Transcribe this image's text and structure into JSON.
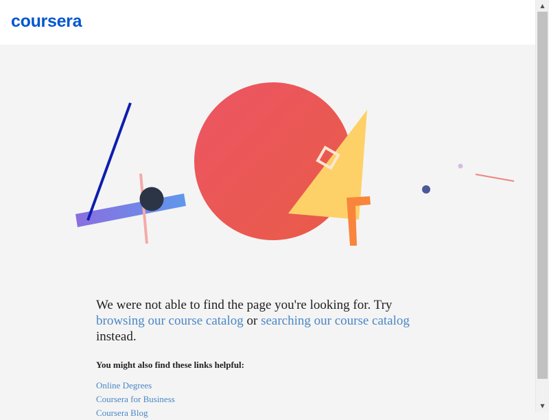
{
  "brand": {
    "logo_text": "coursera",
    "logo_color": "#0056d2"
  },
  "colors": {
    "link": "#4a86c6",
    "text": "#1f1f1f",
    "background": "#f4f4f4"
  },
  "illustration": {
    "depicts": "404"
  },
  "message": {
    "intro": "We were not able to find the page you're looking for. Try",
    "browse_link": "browsing our course catalog",
    "or_text": "or",
    "search_link": "searching our course catalog",
    "outro": "instead."
  },
  "helpful": {
    "heading": "You might also find these links helpful:",
    "links": [
      "Online Degrees",
      "Coursera for Business",
      "Coursera Blog"
    ]
  },
  "scrollbar": {
    "up_icon": "triangle-up-icon",
    "down_icon": "triangle-down-icon"
  }
}
